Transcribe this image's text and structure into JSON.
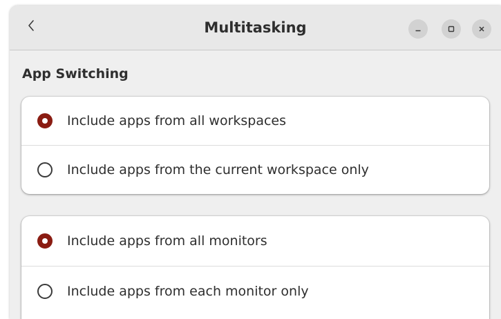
{
  "window": {
    "title": "Multitasking",
    "back_icon": "chevron-left-icon",
    "controls": {
      "minimize_icon": "minimize-icon",
      "maximize_icon": "maximize-icon",
      "close_icon": "close-icon"
    }
  },
  "app_switching": {
    "heading": "App Switching",
    "groups": [
      {
        "options": [
          {
            "label": "Include apps from all workspaces",
            "selected": true
          },
          {
            "label": "Include apps from the current workspace only",
            "selected": false
          }
        ]
      },
      {
        "options": [
          {
            "label": "Include apps from all monitors",
            "selected": true
          },
          {
            "label": "Include apps from each monitor only",
            "selected": false
          }
        ]
      }
    ]
  },
  "colors": {
    "accent": "#8a1c12",
    "window_bg": "#efefef",
    "titlebar_bg": "#e8e8e8",
    "card_bg": "#ffffff",
    "text": "#2e2e2e"
  }
}
